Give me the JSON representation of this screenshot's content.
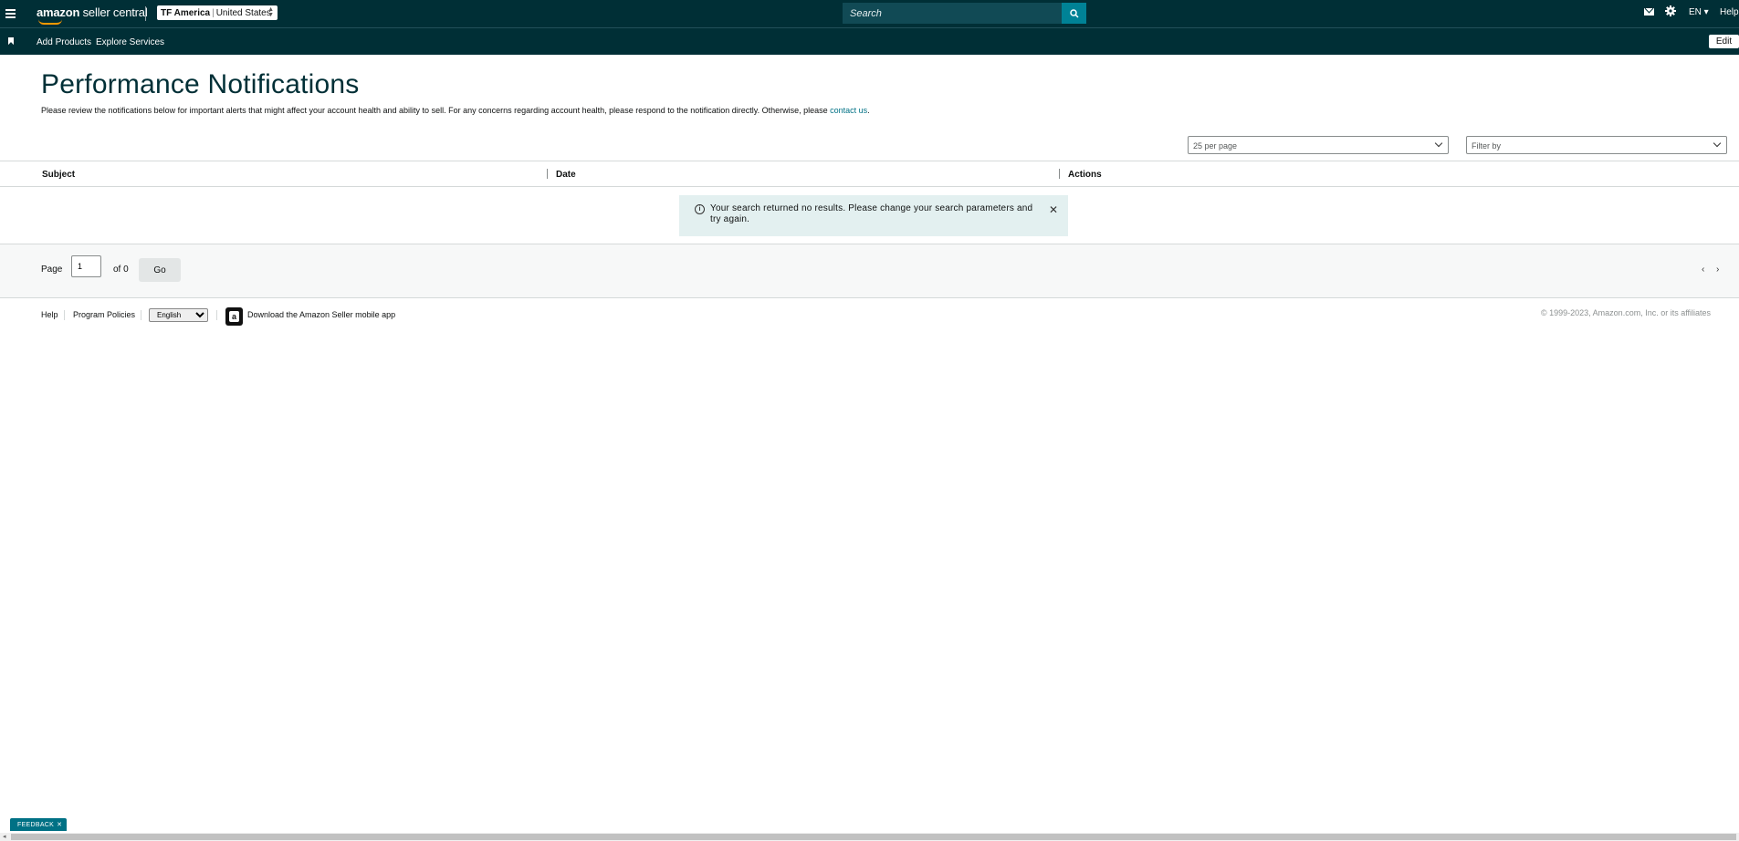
{
  "header": {
    "logo_prefix": "amazon",
    "logo_suffix": "seller central",
    "account_name": "TF America",
    "account_region": "United States",
    "search_placeholder": "Search",
    "language": "EN ▾",
    "help": "Help",
    "icons": [
      "menu-icon",
      "mail-icon",
      "gear-icon",
      "search-icon"
    ]
  },
  "nav": {
    "items": [
      {
        "label": "Add Products"
      },
      {
        "label": "Explore Services"
      }
    ],
    "edit_label": "Edit"
  },
  "page": {
    "title": "Performance Notifications",
    "description": "Please review the notifications below for important alerts that might affect your account health and ability to sell. For any concerns regarding account health, please respond to the notification directly. Otherwise, please ",
    "contact_link": "contact us",
    "contact_suffix": "."
  },
  "filters": {
    "per_page": "25 per page",
    "filter_placeholder": "Filter by"
  },
  "table": {
    "columns": [
      "Subject",
      "Date",
      "Actions"
    ],
    "rows": []
  },
  "alert": {
    "message": "Your search returned no results. Please change your search parameters and try again."
  },
  "pagination": {
    "page_label": "Page",
    "current_page": "1",
    "of_label": "of 0",
    "go_label": "Go"
  },
  "footer": {
    "help": "Help",
    "program_policies": "Program Policies",
    "language_selected": "English",
    "app_download": "Download the Amazon Seller mobile app",
    "copyright": "© 1999-2023, Amazon.com, Inc. or its affiliates"
  },
  "feedback": {
    "label": "FEEDBACK"
  },
  "colors": {
    "header_bg": "#002f36",
    "accent": "#008296",
    "link": "#007185",
    "alert_bg": "#e3f0f0"
  }
}
